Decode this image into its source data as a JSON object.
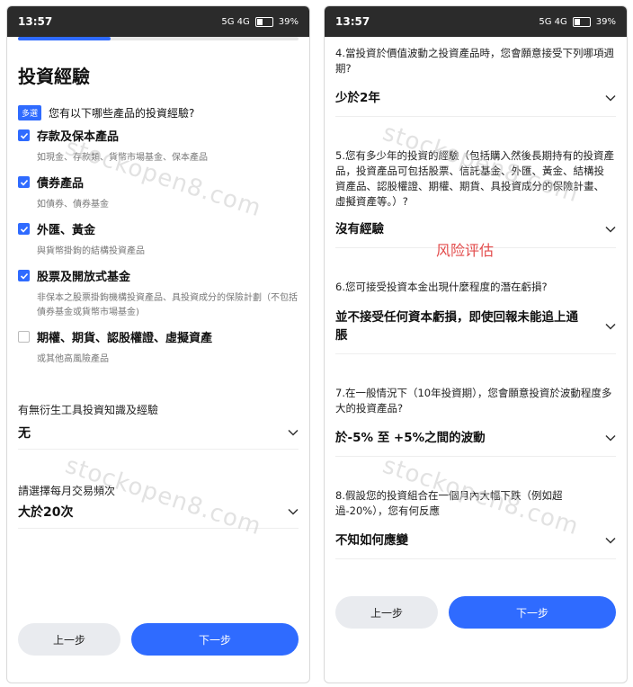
{
  "status": {
    "time": "13:57",
    "net": "5G 4G",
    "battery": "39%",
    "battery_level": 0.39
  },
  "left": {
    "progress": 0.33,
    "title": "投資經驗",
    "multi_tag": "多選",
    "question": "您有以下哪些產品的投資經驗?",
    "options": [
      {
        "label": "存款及保本產品",
        "sub": "如現金、存款類、貨幣市場基金、保本產品",
        "checked": true
      },
      {
        "label": "債券產品",
        "sub": "如債券、債券基金",
        "checked": true
      },
      {
        "label": "外匯、黃金",
        "sub": "與貨幣掛鉤的結構投資產品",
        "checked": true
      },
      {
        "label": "股票及開放式基金",
        "sub": "非保本之股票掛鉤機構投資產品、具投資成分的保險計劃（不包括債券基金或貨幣市場基金)",
        "checked": true
      },
      {
        "label": "期權、期貨、認股權證、虛擬資產",
        "sub": "或其他高風險產品",
        "checked": false
      }
    ],
    "deriv_label": "有無衍生工具投資知識及經驗",
    "deriv_value": "无",
    "freq_label": "請選擇每月交易頻次",
    "freq_value": "大於20次",
    "prev": "上一步",
    "next": "下一步",
    "watermark": "stockopen8.com"
  },
  "right": {
    "q4": "4.當投資於價值波動之投資產品時，您會願意接受下列哪項週期?",
    "a4": "少於2年",
    "q5": "5.您有多少年的投資的經驗（包括購入然後長期持有的投資產品，投資產品可包括股票、信託基金、外匯、黃金、結構投資產品、認股權證、期權、期貨、具投資成分的保險計畫、虛擬資產等。）?",
    "a5": "沒有經驗",
    "note": "风险评估",
    "q6": "6.您可接受投資本金出現什麼程度的潛在虧損?",
    "a6": "並不接受任何資本虧損，即使回報未能追上通脹",
    "q7": "7.在一般情況下（10年投資期），您會願意投資於波動程度多大的投資產品?",
    "a7": "於-5% 至 +5%之間的波動",
    "q8": "8.假設您的投資組合在一個月內大幅下跌（例如超過-20%），您有何反應",
    "a8": "不知如何應變",
    "prev": "上一步",
    "next": "下一步",
    "watermark": "stockopen8.com"
  }
}
